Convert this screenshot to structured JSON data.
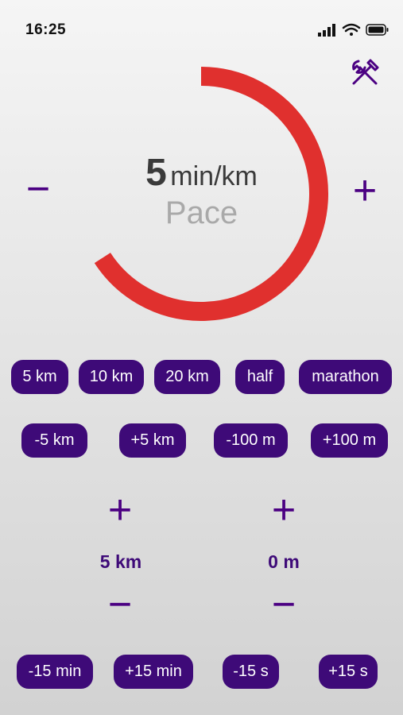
{
  "status_bar": {
    "time": "16:25"
  },
  "pace": {
    "value": "5",
    "unit": "min/km",
    "label": "Pace"
  },
  "controls": {
    "minus": "−",
    "plus": "+"
  },
  "distance_presets": [
    "5 km",
    "10 km",
    "20 km",
    "half",
    "marathon"
  ],
  "distance_adjust": [
    "-5 km",
    "+5 km",
    "-100 m",
    "+100 m"
  ],
  "distance_display": {
    "km": "5 km",
    "m": "0 m"
  },
  "time_adjust": [
    "-15 min",
    "+15 min",
    "-15 s",
    "+15 s"
  ],
  "colors": {
    "accent": "#3e0a78",
    "ring": "#e0302e",
    "text": "#3a3a3a",
    "label": "#a9a9a9"
  },
  "icons": [
    "tools-icon",
    "signal-icon",
    "wifi-icon",
    "battery-icon"
  ]
}
